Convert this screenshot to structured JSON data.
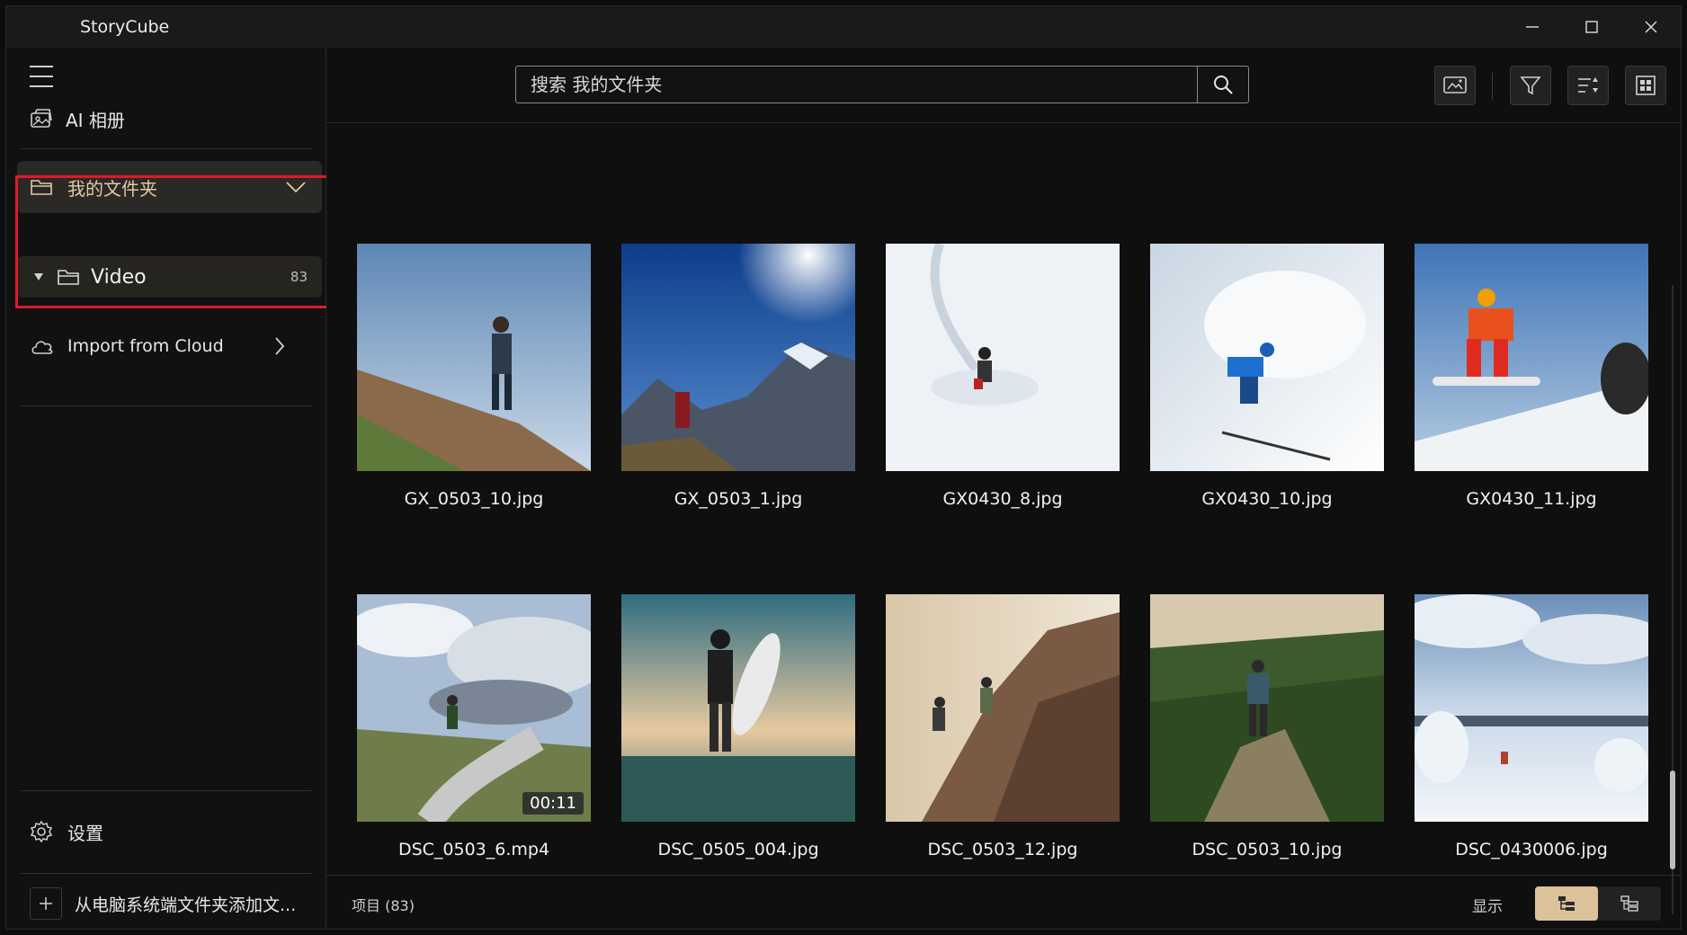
{
  "app": {
    "title": "StoryCube"
  },
  "sidebar": {
    "ai_album": "AI 相册",
    "my_folder": "我的文件夹",
    "video_folder": {
      "label": "Video",
      "count": "83"
    },
    "import_cloud": "Import from Cloud",
    "settings": "设置",
    "add_folder": "从电脑系统端文件夹添加文..."
  },
  "search": {
    "placeholder": "搜索 我的文件夹"
  },
  "files": [
    {
      "name": "GX_0503_10.jpg",
      "scene": "hiker"
    },
    {
      "name": "GX_0503_1.jpg",
      "scene": "mountain"
    },
    {
      "name": "GX0430_8.jpg",
      "scene": "snow-ski"
    },
    {
      "name": "GX0430_10.jpg",
      "scene": "snow-blue"
    },
    {
      "name": "GX0430_11.jpg",
      "scene": "snowboard"
    },
    {
      "name": "DSC_0503_6.mp4",
      "scene": "cloudy-hill",
      "duration": "00:11"
    },
    {
      "name": "DSC_0505_004.jpg",
      "scene": "surf"
    },
    {
      "name": "DSC_0503_12.jpg",
      "scene": "rock-climb"
    },
    {
      "name": "DSC_0503_10.jpg",
      "scene": "forest"
    },
    {
      "name": "DSC_0430006.jpg",
      "scene": "winter-field"
    }
  ],
  "status": {
    "items": "项目 (83)",
    "show": "显示"
  },
  "colors": {
    "accent": "#dcc29b",
    "folder_text": "#e3c9a2",
    "highlight": "#e0192c"
  }
}
